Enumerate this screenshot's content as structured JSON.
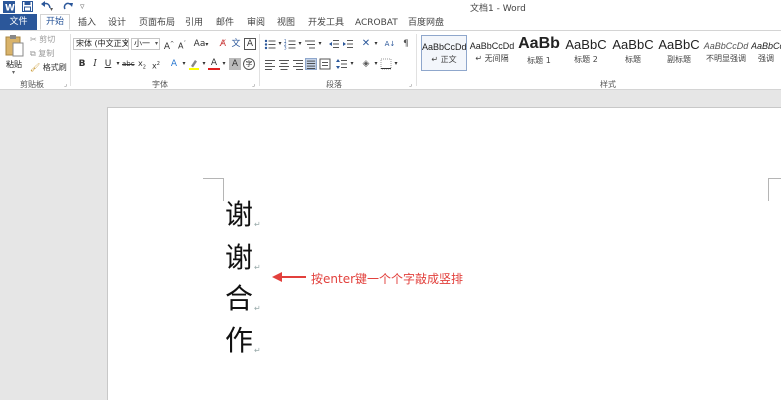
{
  "window": {
    "title": "文档1 - Word"
  },
  "quick_access": {
    "app_icon": "word-logo-icon",
    "save": "save-icon",
    "undo": "undo-icon",
    "redo": "redo-icon",
    "customize": "▿"
  },
  "tabs": [
    {
      "label": "文件"
    },
    {
      "label": "开始"
    },
    {
      "label": "插入"
    },
    {
      "label": "设计"
    },
    {
      "label": "页面布局"
    },
    {
      "label": "引用"
    },
    {
      "label": "邮件"
    },
    {
      "label": "审阅"
    },
    {
      "label": "视图"
    },
    {
      "label": "开发工具"
    },
    {
      "label": "ACROBAT"
    },
    {
      "label": "百度网盘"
    }
  ],
  "clipboard": {
    "paste": "粘贴",
    "cut": "剪切",
    "copy": "复制",
    "format_painter": "格式刷",
    "group": "剪贴板"
  },
  "font": {
    "family": "宋体 (中文正文)",
    "size": "小一",
    "group": "字体"
  },
  "paragraph": {
    "group": "段落"
  },
  "styles": {
    "group": "样式",
    "items": [
      {
        "sample": "AaBbCcDd",
        "name": "↵ 正文"
      },
      {
        "sample": "AaBbCcDd",
        "name": "↵ 无间隔"
      },
      {
        "sample": "AaBb",
        "name": "标题 1"
      },
      {
        "sample": "AaBbC",
        "name": "标题 2"
      },
      {
        "sample": "AaBbC",
        "name": "标题"
      },
      {
        "sample": "AaBbC",
        "name": "副标题"
      },
      {
        "sample": "AaBbCcDd",
        "name": "不明显强调"
      },
      {
        "sample": "AaBbCcDd",
        "name": "强调"
      }
    ]
  },
  "document": {
    "chars": [
      "谢",
      "谢",
      "合",
      "作"
    ],
    "para_mark": "↵",
    "annotation": "按enter键一个个字敲成竖排"
  },
  "colors": {
    "accent": "#2b579a",
    "annotation": "#e2403c"
  }
}
